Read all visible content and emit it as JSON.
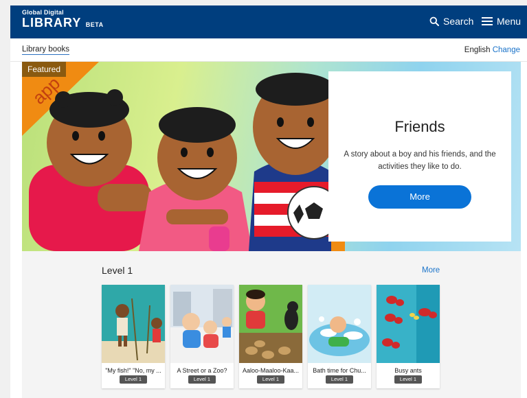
{
  "header": {
    "logo_top": "Global Digital",
    "logo_main": "LIBRARY",
    "logo_beta": "BETA",
    "search_label": "Search",
    "menu_label": "Menu",
    "color": "#003e7e"
  },
  "subbar": {
    "breadcrumb": "Library books",
    "language": "English",
    "change_label": "Change"
  },
  "featured": {
    "tag": "Featured",
    "ribbon_text": "app",
    "title": "Friends",
    "description": "A story about a boy and his friends, and the activities they like to do.",
    "more_label": "More",
    "button_color": "#0a73d7"
  },
  "level": {
    "title": "Level 1",
    "more_label": "More",
    "books": [
      {
        "title": "\"My fish!\" \"No, my ...",
        "level": "Level 1"
      },
      {
        "title": "A Street or a Zoo?",
        "level": "Level 1"
      },
      {
        "title": "Aaloo-Maaloo-Kaa...",
        "level": "Level 1"
      },
      {
        "title": "Bath time for Chu...",
        "level": "Level 1"
      },
      {
        "title": "Busy ants",
        "level": "Level 1"
      }
    ]
  }
}
